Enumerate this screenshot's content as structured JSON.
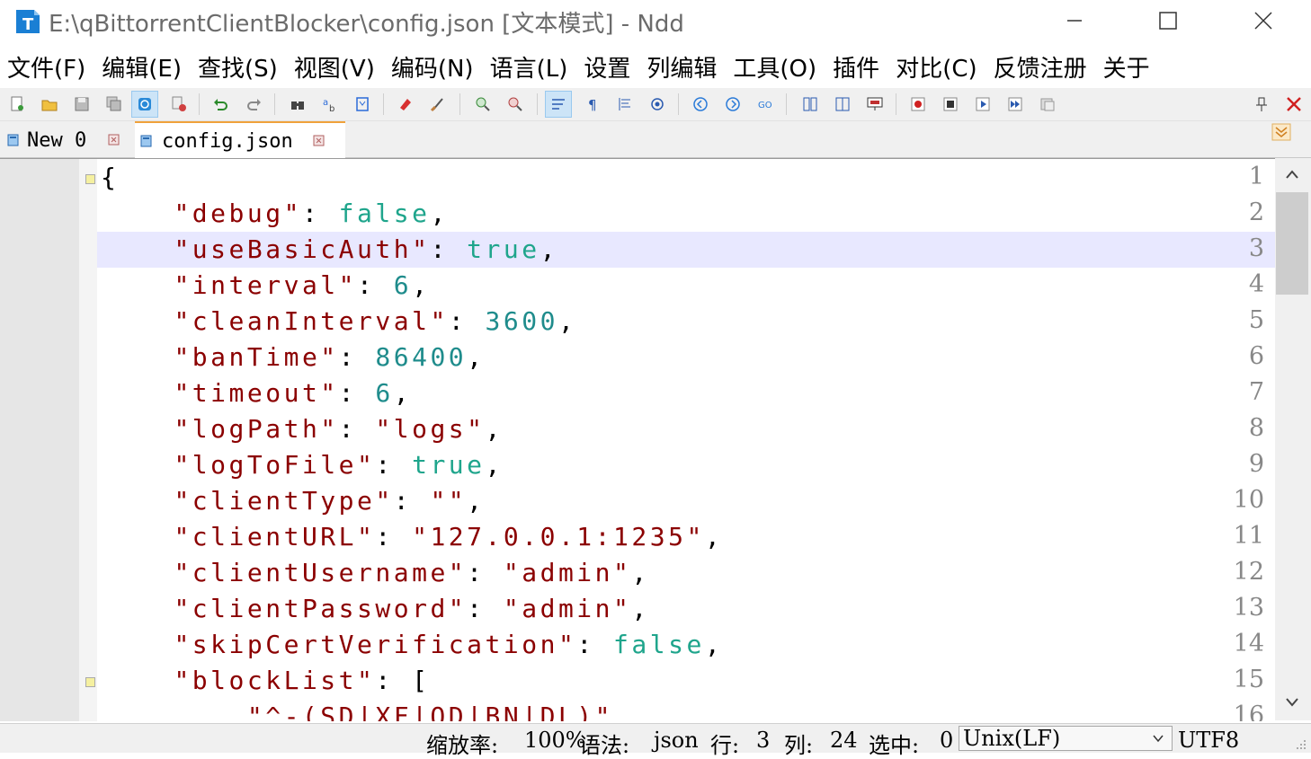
{
  "window": {
    "title": "E:\\qBittorrentClientBlocker\\config.json [文本模式] - Ndd",
    "icon_letter": "T",
    "controls": [
      "minimize-icon",
      "maximize-icon",
      "close-icon"
    ]
  },
  "menu": [
    "文件(F)",
    "编辑(E)",
    "查找(S)",
    "视图(V)",
    "编码(N)",
    "语言(L)",
    "设置",
    "列编辑",
    "工具(O)",
    "插件",
    "对比(C)",
    "反馈注册",
    "关于"
  ],
  "tabs": [
    {
      "label": "New 0",
      "active": false
    },
    {
      "label": "config.json",
      "active": true
    }
  ],
  "editor": {
    "highlighted_line": 3,
    "lines": [
      {
        "n": "1",
        "text": "{",
        "fold": true
      },
      {
        "n": "2",
        "key": "\"debug\"",
        "val": "false",
        "vtype": "kw",
        "tail": ","
      },
      {
        "n": "3",
        "key": "\"useBasicAuth\"",
        "val": "true",
        "vtype": "kw",
        "tail": ","
      },
      {
        "n": "4",
        "key": "\"interval\"",
        "val": "6",
        "vtype": "num",
        "tail": ","
      },
      {
        "n": "5",
        "key": "\"cleanInterval\"",
        "val": "3600",
        "vtype": "num",
        "tail": ","
      },
      {
        "n": "6",
        "key": "\"banTime\"",
        "val": "86400",
        "vtype": "num",
        "tail": ","
      },
      {
        "n": "7",
        "key": "\"timeout\"",
        "val": "6",
        "vtype": "num",
        "tail": ","
      },
      {
        "n": "8",
        "key": "\"logPath\"",
        "val": "\"logs\"",
        "vtype": "str",
        "tail": ","
      },
      {
        "n": "9",
        "key": "\"logToFile\"",
        "val": "true",
        "vtype": "kw",
        "tail": ","
      },
      {
        "n": "10",
        "key": "\"clientType\"",
        "val": "\"\"",
        "vtype": "str",
        "tail": ","
      },
      {
        "n": "11",
        "key": "\"clientURL\"",
        "val": "\"127.0.0.1:1235\"",
        "vtype": "str",
        "tail": ","
      },
      {
        "n": "12",
        "key": "\"clientUsername\"",
        "val": "\"admin\"",
        "vtype": "str",
        "tail": ","
      },
      {
        "n": "13",
        "key": "\"clientPassword\"",
        "val": "\"admin\"",
        "vtype": "str",
        "tail": ","
      },
      {
        "n": "14",
        "key": "\"skipCertVerification\"",
        "val": "false",
        "vtype": "kw",
        "tail": ","
      },
      {
        "n": "15",
        "key": "\"blockList\"",
        "val": "[",
        "vtype": "pun",
        "tail": "",
        "fold": true
      },
      {
        "n": "16",
        "text": "        \"^-(SD|XF|QD|BN|DL)\",",
        "vtype": "str"
      }
    ]
  },
  "status": {
    "zoom_label": "缩放率:",
    "zoom_value": "100%",
    "lang_label": "语法:",
    "lang_value": "json",
    "row_label": "行:",
    "row_value": "3",
    "col_label": "列:",
    "col_value": "24",
    "sel_label": "选中:",
    "sel_value": "0",
    "eol": "Unix(LF)",
    "encoding": "UTF8"
  },
  "colors": {
    "key": "#8b0000",
    "keyword": "#1fa58c",
    "number": "#1f8c8c",
    "highlight": "#e8e8ff",
    "tab_accent": "#f0a23b"
  }
}
